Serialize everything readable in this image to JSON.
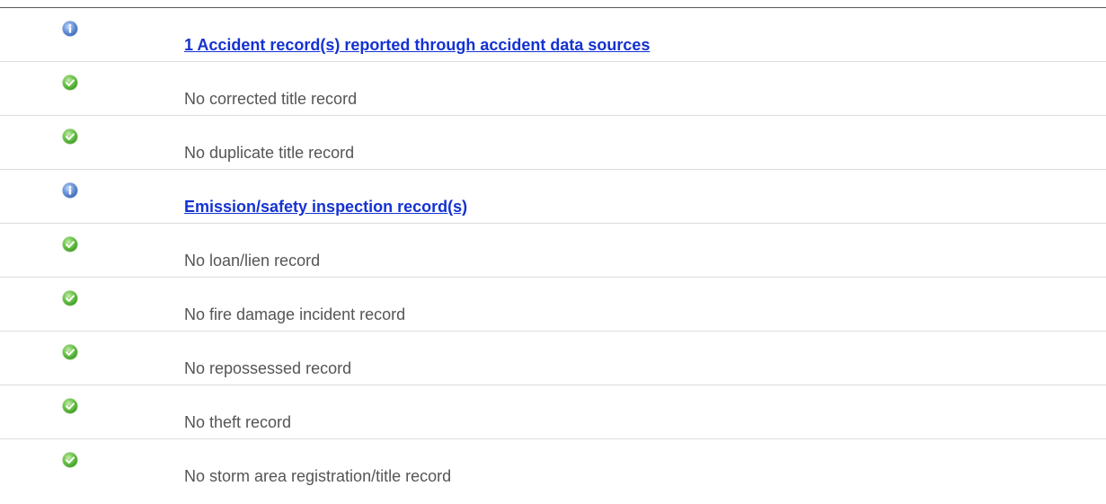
{
  "colors": {
    "link": "#1432d2",
    "text": "#555555",
    "divider": "#dcdcdc",
    "info_icon": "#4f7fd0",
    "check_icon": "#5cb83a"
  },
  "records": [
    {
      "status": "info",
      "icon": "info-icon",
      "text": "1 Accident record(s) reported through accident data sources",
      "link": true
    },
    {
      "status": "ok",
      "icon": "check-icon",
      "text": "No corrected title record",
      "link": false
    },
    {
      "status": "ok",
      "icon": "check-icon",
      "text": "No duplicate title record",
      "link": false
    },
    {
      "status": "info",
      "icon": "info-icon",
      "text": "Emission/safety inspection record(s)",
      "link": true
    },
    {
      "status": "ok",
      "icon": "check-icon",
      "text": "No loan/lien record",
      "link": false
    },
    {
      "status": "ok",
      "icon": "check-icon",
      "text": "No fire damage incident record",
      "link": false
    },
    {
      "status": "ok",
      "icon": "check-icon",
      "text": "No repossessed record",
      "link": false
    },
    {
      "status": "ok",
      "icon": "check-icon",
      "text": "No theft record",
      "link": false
    },
    {
      "status": "ok",
      "icon": "check-icon",
      "text": "No storm area registration/title record",
      "link": false
    }
  ]
}
